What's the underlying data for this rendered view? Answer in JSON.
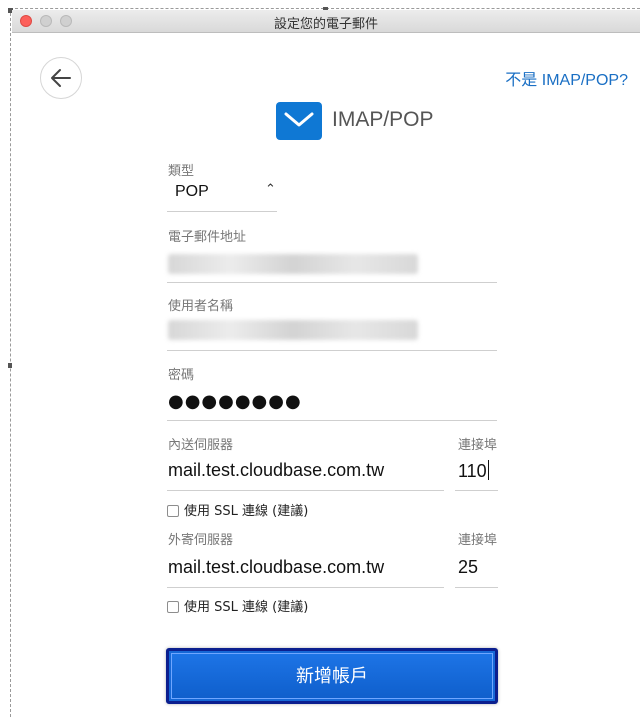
{
  "window": {
    "title": "設定您的電子郵件"
  },
  "nav": {
    "not_imap_link": "不是 IMAP/POP?"
  },
  "header": {
    "protocol_label": "IMAP/POP"
  },
  "form": {
    "type": {
      "label": "類型",
      "value": "POP"
    },
    "email": {
      "label": "電子郵件地址"
    },
    "username": {
      "label": "使用者名稱"
    },
    "password": {
      "label": "密碼",
      "masked_value": "●●●●●●●●"
    },
    "incoming": {
      "label": "內送伺服器",
      "value": "mail.test.cloudbase.com.tw",
      "port_label": "連接埠",
      "port_value": "110",
      "ssl_label": "使用 SSL 連線 (建議)",
      "ssl_checked": false
    },
    "outgoing": {
      "label": "外寄伺服器",
      "value": "mail.test.cloudbase.com.tw",
      "port_label": "連接埠",
      "port_value": "25",
      "ssl_label": "使用 SSL 連線 (建議)",
      "ssl_checked": false
    }
  },
  "actions": {
    "add_account_label": "新增帳戶"
  },
  "icons": {
    "back": "arrow-left-icon",
    "mail": "envelope-icon",
    "chevron": "chevron-up-down-icon"
  },
  "colors": {
    "accent": "#0f78d4",
    "link": "#1a6fc4",
    "button": "#1668d6",
    "button_border": "#0b1f8f",
    "close": "#fc605b"
  }
}
